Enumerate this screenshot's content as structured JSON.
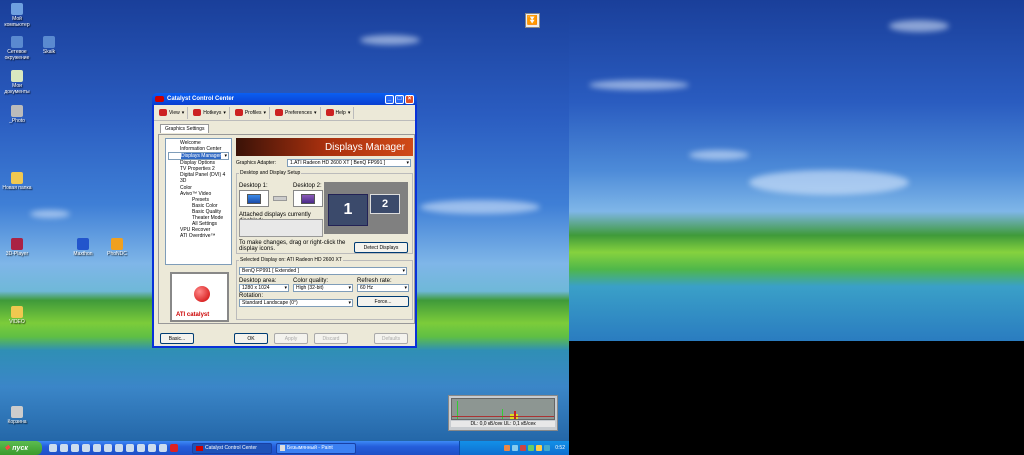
{
  "desktop_icons": [
    {
      "label": "Мой компьютер",
      "color": "#6fa0e0"
    },
    {
      "label": "Сетевое окружение",
      "color": "#5a8ad0"
    },
    {
      "label": "Skalk",
      "color": "#5a8ad0"
    },
    {
      "label": "Мои документы",
      "color": "#d8e8c0"
    },
    {
      "label": "_Photo",
      "color": "#bbbbbb"
    },
    {
      "label": "Новая папка",
      "color": "#f0c850"
    },
    {
      "label": "3D-Player",
      "color": "#aa2244"
    },
    {
      "label": "Maxthon",
      "color": "#2255cc"
    },
    {
      "label": "PhoNDC",
      "color": "#f0a020"
    },
    {
      "label": "VIDEO",
      "color": "#f0c850"
    },
    {
      "label": "Корзина",
      "color": "#cccccc"
    }
  ],
  "window": {
    "title": "Catalyst Control Center",
    "toolbar": [
      "View",
      "Hotkeys",
      "Profiles",
      "Preferences",
      "Help"
    ],
    "tab": "Graphics Settings",
    "tree": [
      {
        "label": "Welcome",
        "level": 0
      },
      {
        "label": "Information Center",
        "level": 0
      },
      {
        "label": "Displays Manager",
        "level": 0,
        "selected": true
      },
      {
        "label": "Display Options",
        "level": 0
      },
      {
        "label": "TV Properties 2",
        "level": 0
      },
      {
        "label": "Digital Panel (DVI) 4",
        "level": 0
      },
      {
        "label": "3D",
        "level": 0
      },
      {
        "label": "Color",
        "level": 0
      },
      {
        "label": "Avivo™ Video",
        "level": 0
      },
      {
        "label": "Presets",
        "level": 1
      },
      {
        "label": "Basic Color",
        "level": 1
      },
      {
        "label": "Basic Quality",
        "level": 1
      },
      {
        "label": "Theater Mode",
        "level": 1
      },
      {
        "label": "All Settings",
        "level": 1
      },
      {
        "label": "VPU Recover",
        "level": 0
      },
      {
        "label": "ATI Overdrive™",
        "level": 0
      }
    ],
    "logo_text": "ATI catalyst",
    "banner": "Displays Manager",
    "adapter_label": "Graphics Adapter:",
    "adapter_value": "1.ATI Radeon HD 2600 XT [ BenQ FP991 ]",
    "setup_legend": "Desktop and Display Setup",
    "desktop1": "Desktop 1:",
    "desktop2": "Desktop 2:",
    "disabled_label": "Attached displays currently disabled:",
    "hint": "To make changes, drag or right-click the display icons.",
    "detect": "Detect Displays",
    "mon1": "1",
    "mon2": "2",
    "selected_legend": "Selected Display on: ATI Radeon HD 2600 XT",
    "selected_value": "BenQ FP991  [ Extended ]",
    "area_label": "Desktop area:",
    "area_value": "1280 x 1024",
    "color_label": "Color quality:",
    "color_value": "High (32-bit)",
    "refresh_label": "Refresh rate:",
    "refresh_value": "60 Hz",
    "rotation_label": "Rotation:",
    "rotation_value": "Standard Landscape (0°)",
    "force": "Force...",
    "buttons": {
      "basic": "Basic...",
      "ok": "OK",
      "apply": "Apply",
      "discard": "Discard",
      "defaults": "Defaults"
    }
  },
  "netmon": "DL: 0,0 кБ/сек  UL: 0,1 кБ/сек",
  "taskbar": {
    "start": "пуск",
    "tasks": [
      "Catalyst Control Center",
      "Безымянный - Paint"
    ],
    "clock": "0:52"
  }
}
